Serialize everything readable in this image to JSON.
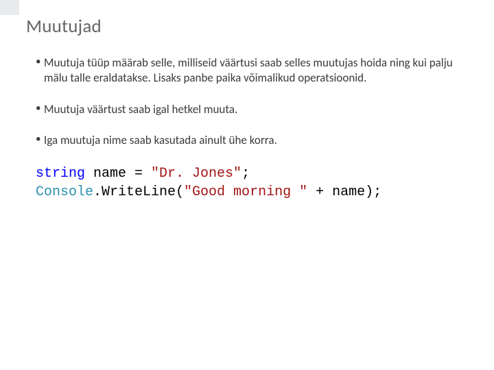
{
  "title": "Muutujad",
  "bullets": [
    "Muutuja tüüp määrab selle, milliseid väärtusi saab selles muutujas hoida ning kui palju mälu talle eraldatakse. Lisaks panbe paika võimalikud operatsioonid.",
    "Muutuja väärtust saab igal hetkel muuta.",
    "Iga muutuja nime saab kasutada ainult ühe korra."
  ],
  "code": {
    "line1": {
      "kw": "string",
      "ident": " name = ",
      "str": "\"Dr. Jones\"",
      "end": ";"
    },
    "line2": {
      "cls": "Console",
      "call1": ".WriteLine(",
      "str": "\"Good morning \"",
      "call2": " + name);"
    }
  }
}
